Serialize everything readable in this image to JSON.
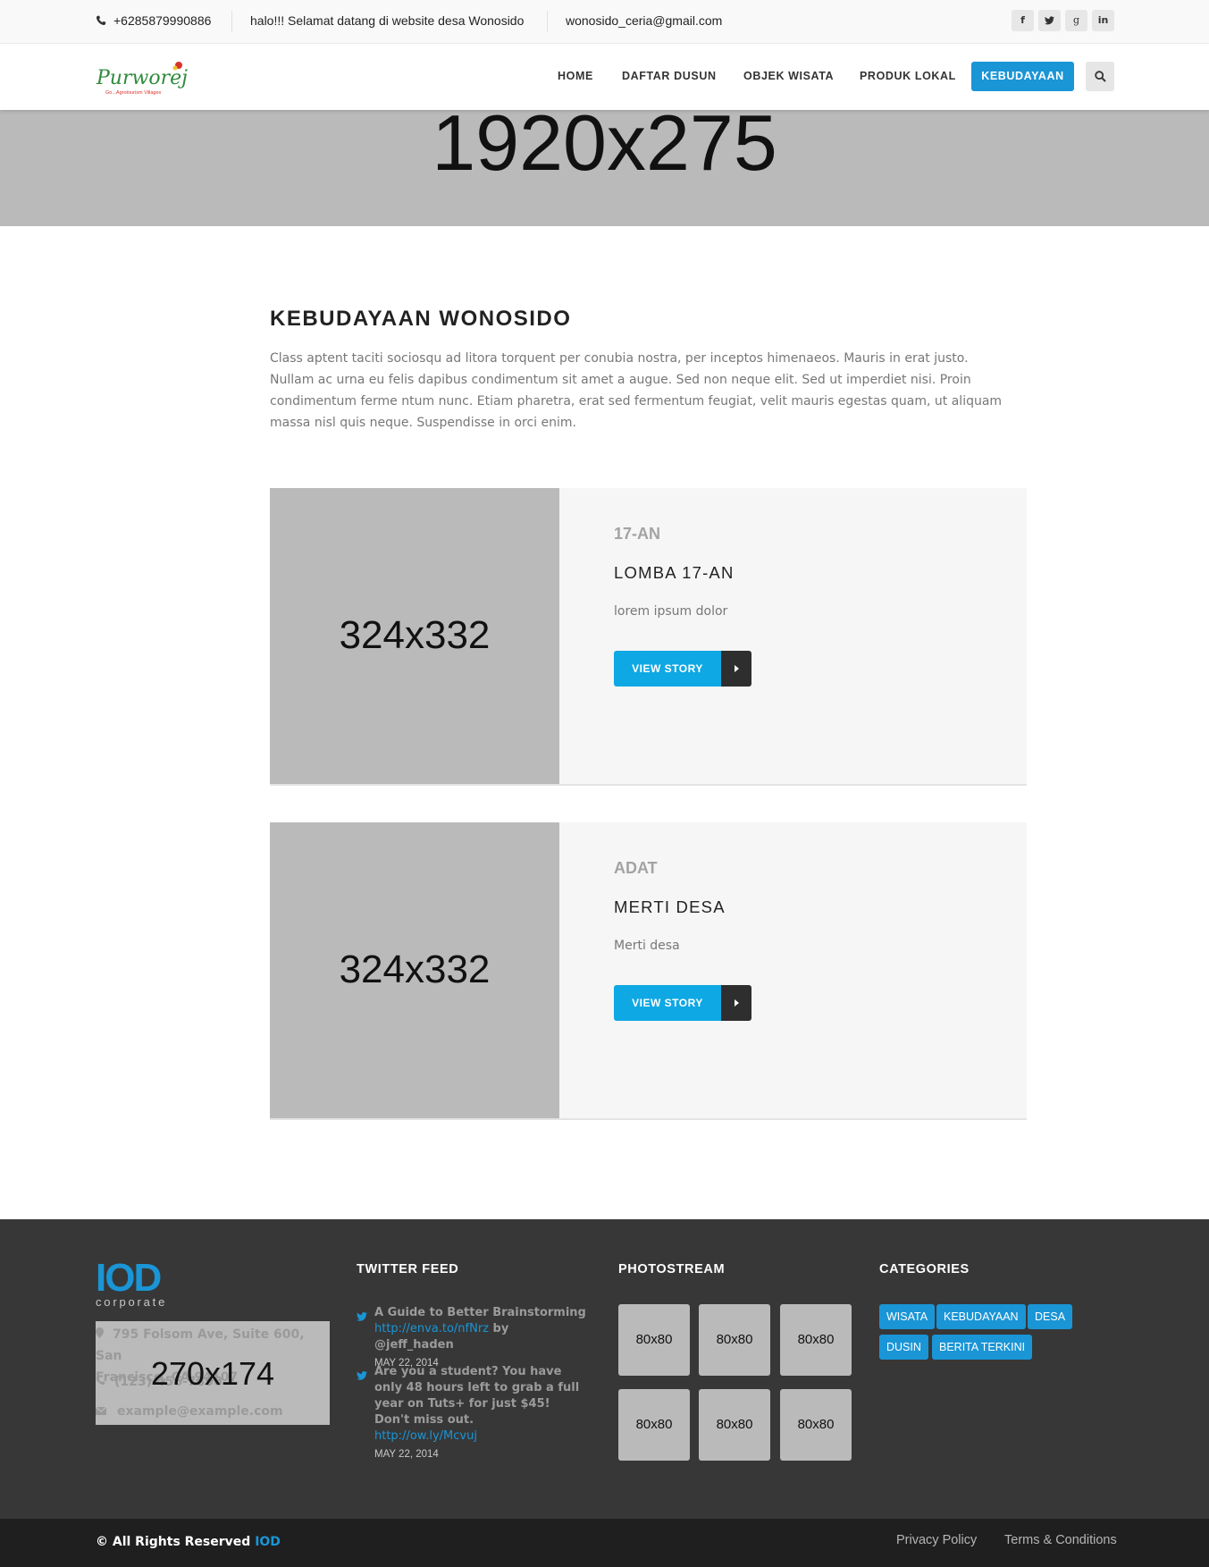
{
  "topbar": {
    "phone": "+6285879990886",
    "welcome": "halo!!! Selamat datang di website desa Wonosido",
    "email": "wonosido_ceria@gmail.com",
    "social": [
      "f",
      "t",
      "g",
      "in"
    ]
  },
  "header": {
    "logo_text": "Purworejo",
    "logo_tagline": "Go...Agrotourism Villages",
    "nav": [
      "HOME",
      "DAFTAR DUSUN",
      "OBJEK WISATA",
      "PRODUK LOKAL",
      "KEBUDAYAAN"
    ],
    "active_nav": "KEBUDAYAAN"
  },
  "hero": {
    "placeholder": "1920x275"
  },
  "main": {
    "title": "KEBUDAYAAN WONOSIDO",
    "description": "Class aptent taciti sociosqu ad litora torquent per conubia nostra, per inceptos himenaeos. Mauris in erat justo. Nullam ac urna eu felis dapibus condimentum sit amet a augue. Sed non neque elit. Sed ut imperdiet nisi. Proin condimentum ferme ntum nunc. Etiam pharetra, erat sed fermentum feugiat, velit mauris egestas quam, ut aliquam massa nisl quis neque. Suspendisse in orci enim.",
    "stories": [
      {
        "image": "324x332",
        "category": "17-AN",
        "title": "LOMBA 17-AN",
        "excerpt": "lorem ipsum dolor",
        "button": "VIEW STORY"
      },
      {
        "image": "324x332",
        "category": "ADAT",
        "title": "MERTI DESA",
        "excerpt": "Merti desa",
        "button": "VIEW STORY"
      }
    ]
  },
  "footer": {
    "logo_big": "IOD",
    "logo_small": "corporate",
    "contact": {
      "address": "795 Folsom Ave, Suite 600, San Francisco, CA 94107",
      "address_line1": "795 Folsom Ave, Suite 600, San",
      "address_line2": "Francisco, CA 94107",
      "phone": "(123) 456-7890",
      "email": "example@example.com",
      "placeholder": "270x174"
    },
    "twitter": {
      "heading": "TWITTER FEED",
      "tweets": [
        {
          "text": "A Guide to Better Brainstorming",
          "link": "http://enva.to/nfNrz",
          "suffix": " by @jeff_haden",
          "date": "MAY 22, 2014"
        },
        {
          "text": "Are you a student? You have only 48 hours left to grab a full year on Tuts+ for just $45! Don't miss out.",
          "link": "http://ow.ly/Mcvuj",
          "suffix": "",
          "date": "MAY 22, 2014"
        }
      ]
    },
    "photostream": {
      "heading": "PHOTOSTREAM",
      "photos": [
        "80x80",
        "80x80",
        "80x80",
        "80x80",
        "80x80",
        "80x80"
      ]
    },
    "categories": {
      "heading": "CATEGORIES",
      "tags": [
        "WISATA",
        "KEBUDAYAAN",
        "DESA",
        "DUSIN",
        "BERITA TERKINI"
      ]
    }
  },
  "bottombar": {
    "copyright": "© All Rights Reserved",
    "brand": "IOD",
    "links": [
      "Privacy Policy",
      "Terms & Conditions"
    ]
  },
  "colors": {
    "accent": "#1a95d6",
    "button": "#0ea8e4",
    "footer": "#373737",
    "bottombar": "#1f1f1f",
    "placeholder": "#bababa"
  }
}
